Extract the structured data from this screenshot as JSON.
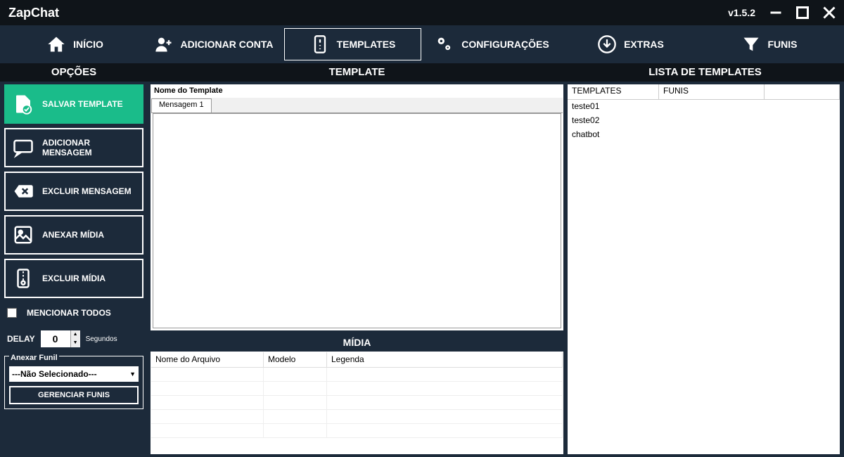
{
  "app": {
    "name": "ZapChat",
    "version": "v1.5.2"
  },
  "nav": {
    "inicio": "INÍCIO",
    "adicionar_conta": "ADICIONAR CONTA",
    "templates": "TEMPLATES",
    "configuracoes": "CONFIGURAÇÕES",
    "extras": "EXTRAS",
    "funis": "FUNIS"
  },
  "headers": {
    "opcoes": "OPÇÕES",
    "template": "TEMPLATE",
    "lista": "LISTA DE TEMPLATES"
  },
  "sidebar": {
    "salvar": "SALVAR TEMPLATE",
    "add_msg": "ADICIONAR MENSAGEM",
    "del_msg": "EXCLUIR MENSAGEM",
    "anexar_midia": "ANEXAR MÍDIA",
    "excluir_midia": "EXCLUIR MÍDIA",
    "mencionar": "MENCIONAR TODOS",
    "delay_label": "DELAY",
    "delay_value": "0",
    "delay_unit": "Segundos",
    "anexar_funil": "Anexar Funil",
    "funil_select": "---Não Selecionado---",
    "gerenciar": "GERENCIAR FUNIS"
  },
  "template": {
    "name_placeholder": "Nome do Template",
    "tab1": "Mensagem 1"
  },
  "midia": {
    "title": "MÍDIA",
    "cols": {
      "arquivo": "Nome do Arquivo",
      "modelo": "Modelo",
      "legenda": "Legenda"
    }
  },
  "list": {
    "cols": {
      "templates": "TEMPLATES",
      "funis": "FUNIS"
    },
    "rows": [
      "teste01",
      "teste02",
      "chatbot"
    ]
  }
}
